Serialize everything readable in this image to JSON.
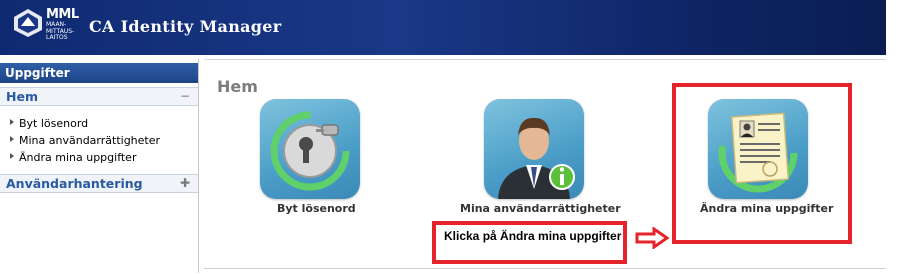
{
  "header": {
    "logo_text": "MML",
    "logo_sub": "MAAN-MITTAUS-LAITOS",
    "app_title": "CA Identity Manager"
  },
  "sidebar": {
    "section_title": "Uppgifter",
    "groups": [
      {
        "label": "Hem",
        "toggle": "−",
        "items": [
          "Byt lösenord",
          "Mina användarrättigheter",
          "Ändra mina uppgifter"
        ]
      },
      {
        "label": "Användarhantering",
        "toggle": "✚",
        "items": []
      }
    ]
  },
  "main": {
    "title": "Hem",
    "tiles": [
      {
        "label": "Byt lösenord",
        "icon": "key-icon"
      },
      {
        "label": "Mina användarrättigheter",
        "icon": "user-info-icon"
      },
      {
        "label": "Ändra mina uppgifter",
        "icon": "document-edit-icon"
      }
    ]
  },
  "annotation": {
    "callout_text": "Klicka på Ändra mina uppgifter",
    "color": "#e4232a"
  },
  "colors": {
    "header_bg": "#1a3887",
    "sidebar_header_bg": "#1d4486",
    "group_label": "#2a5aa4",
    "tile_bg": "#4a9dc7"
  }
}
